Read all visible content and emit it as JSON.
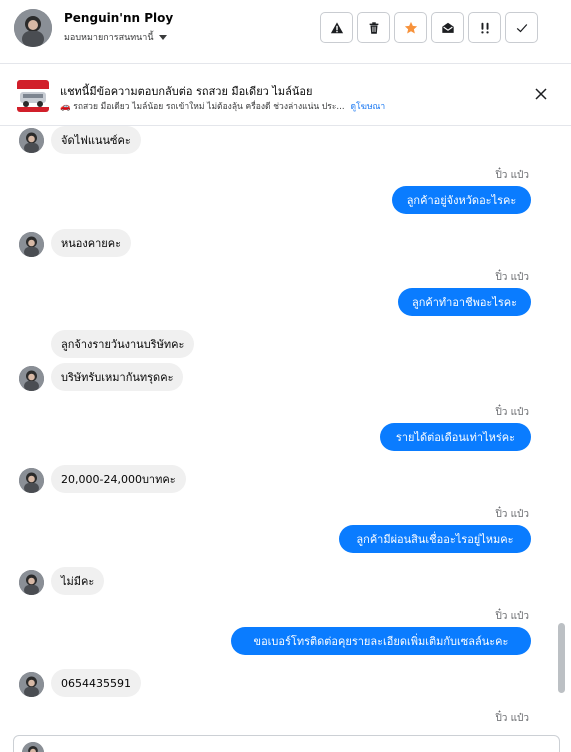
{
  "header": {
    "contact_name": "Penguin'nn Ploy",
    "assign_label": "มอบหมายการสนทนานี้",
    "actions": [
      {
        "name": "warning-icon",
        "label": "Report spam"
      },
      {
        "name": "trash-icon",
        "label": "Delete"
      },
      {
        "name": "star-icon",
        "label": "Star",
        "color": "#f7923b"
      },
      {
        "name": "mark-unread-icon",
        "label": "Mark as unread"
      },
      {
        "name": "follow-up-icon",
        "label": "Follow up"
      },
      {
        "name": "check-icon",
        "label": "Done"
      }
    ]
  },
  "ad_banner": {
    "title": "แชทนี้มีข้อความตอบกลับต่อ รถสวย มือเดียว ไมล์น้อย",
    "subtitle": "🚗 รถสวย มือเดียว ไมล์น้อย รถเข้าใหม่ ไม่ต้องลุ้น ครื่องดี ช่วงล่างแน่น ประ...",
    "view_ad_link": "ดูโฆษณา"
  },
  "messages": [
    {
      "dir": "in",
      "text": "จัดไฟแนนซ์คะ"
    },
    {
      "dir": "out",
      "sender": "ปิ๋ว แป๋ว",
      "text": "ลูกค้าอยู่จังหวัดอะไรคะ"
    },
    {
      "dir": "in",
      "text": "หนองคายคะ"
    },
    {
      "dir": "out",
      "sender": "ปิ๋ว แป๋ว",
      "text": "ลูกค้าทำอาชีพอะไรคะ"
    },
    {
      "dir": "in",
      "text": "ลูกจ้างรายวันงานบริษัทคะ"
    },
    {
      "dir": "in",
      "text": "บริษัทรับเหมากันทรุดคะ"
    },
    {
      "dir": "out",
      "sender": "ปิ๋ว แป๋ว",
      "text": "รายได้ต่อเดือนเท่าไหร่คะ"
    },
    {
      "dir": "in",
      "text": "20,000-24,000บาทคะ"
    },
    {
      "dir": "out",
      "sender": "ปิ๋ว แป๋ว",
      "text": "ลูกค้ามีผ่อนสินเชื่ออะไรอยู่ไหมคะ"
    },
    {
      "dir": "in",
      "text": "ไม่มีคะ"
    },
    {
      "dir": "out",
      "sender": "ปิ๋ว แป๋ว",
      "text": "ขอเบอร์โทรติดต่อคุยรายละเอียดเพิ่มเติมกับเซลล์นะคะ"
    },
    {
      "dir": "in",
      "text": "0654435591"
    },
    {
      "dir": "out",
      "sender": "ปิ๋ว แป๋ว",
      "text": ""
    }
  ],
  "colors": {
    "accent": "#0a7cff",
    "link": "#1877f2",
    "incoming_bubble": "#f0f0f0"
  }
}
